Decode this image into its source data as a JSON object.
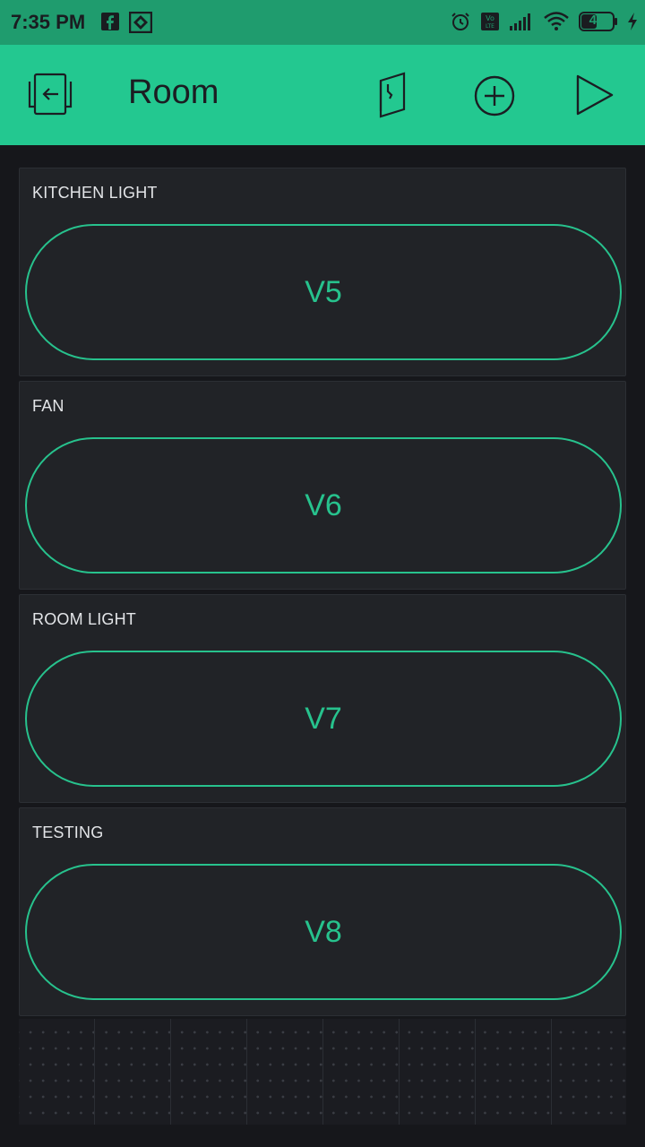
{
  "status_bar": {
    "time": "7:35 PM",
    "battery": "40",
    "left_icons": [
      "facebook-icon",
      "app-notification-icon"
    ],
    "right_icons": [
      "alarm-icon",
      "volte-icon",
      "signal-icon",
      "wifi-icon",
      "battery-icon",
      "charging-icon"
    ]
  },
  "app_bar": {
    "title": "Room",
    "icons": [
      "back-exit-icon",
      "door-icon",
      "add-circle-icon",
      "play-icon"
    ],
    "background": "#23c890"
  },
  "widgets": [
    {
      "label": "KITCHEN LIGHT",
      "pin": "V5"
    },
    {
      "label": "FAN",
      "pin": "V6"
    },
    {
      "label": "ROOM LIGHT",
      "pin": "V7"
    },
    {
      "label": "TESTING",
      "pin": "V8"
    }
  ],
  "colors": {
    "accent": "#27c28d",
    "widget_bg": "#212327",
    "canvas_bg": "#16171b"
  }
}
